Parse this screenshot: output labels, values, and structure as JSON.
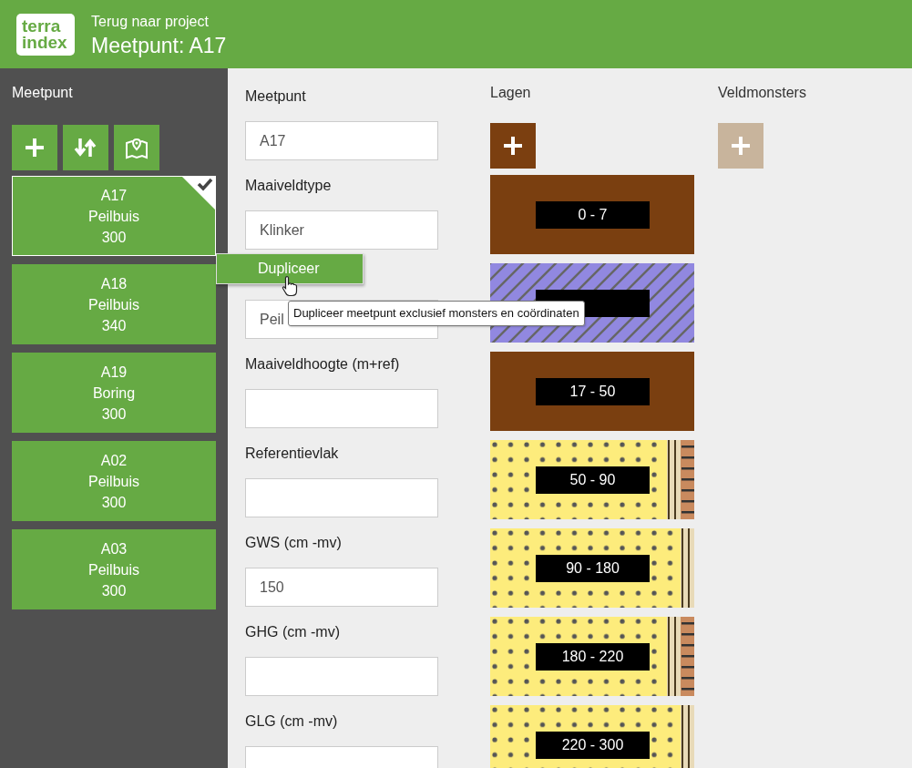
{
  "header": {
    "logo": [
      "terra",
      "index"
    ],
    "back_link": "Terug naar project",
    "title": "Meetpunt: A17"
  },
  "sidebar": {
    "title": "Meetpunt",
    "tools": [
      {
        "kind": "add"
      },
      {
        "kind": "sort"
      },
      {
        "kind": "map"
      }
    ],
    "items": [
      {
        "name": "A17",
        "type": "Peilbuis",
        "depth": "300",
        "selected": true
      },
      {
        "name": "A18",
        "type": "Peilbuis",
        "depth": "340",
        "selected": false
      },
      {
        "name": "A19",
        "type": "Boring",
        "depth": "300",
        "selected": false
      },
      {
        "name": "A02",
        "type": "Peilbuis",
        "depth": "300",
        "selected": false
      },
      {
        "name": "A03",
        "type": "Peilbuis",
        "depth": "300",
        "selected": false
      }
    ]
  },
  "form": {
    "fields": [
      {
        "label": "Meetpunt",
        "value": "A17"
      },
      {
        "label": "Maaiveldtype",
        "value": "Klinker"
      },
      {
        "value": "Peil"
      },
      {
        "label": "Maaiveldhoogte (m+ref)"
      },
      {
        "label": "Referentievlak"
      },
      {
        "label": "GWS (cm -mv)",
        "value": "150"
      },
      {
        "label": "GHG (cm -mv)"
      },
      {
        "label": "GLG (cm -mv)"
      }
    ]
  },
  "layers": {
    "title": "Lagen",
    "add_disabled": false,
    "items": [
      {
        "label": "0 - 7",
        "kind": "clay",
        "casing": false,
        "seal": false
      },
      {
        "kind": "peat",
        "casing": false,
        "seal": false
      },
      {
        "label": "17 - 50",
        "kind": "clay",
        "casing": false,
        "seal": false
      },
      {
        "label": "50 - 90",
        "kind": "sand",
        "casing": true,
        "seal": true
      },
      {
        "label": "90 - 180",
        "kind": "sand",
        "casing": true,
        "seal": false
      },
      {
        "label": "180 - 220",
        "kind": "sand",
        "casing": true,
        "seal": true
      },
      {
        "label": "220 - 300",
        "kind": "sand",
        "casing": true,
        "seal": false
      }
    ]
  },
  "samples": {
    "title": "Veldmonsters",
    "add_disabled": true
  },
  "context_menu": {
    "item": "Dupliceer"
  },
  "tooltip": "Dupliceer meetpunt exclusief monsters en coördinaten"
}
